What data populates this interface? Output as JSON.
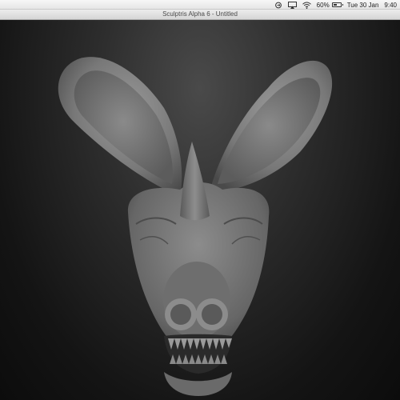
{
  "menubar": {
    "battery_percent": "60%",
    "battery_level": 0.6,
    "date": "Tue 30 Jan",
    "time": "9:40",
    "icons": [
      "sync-icon",
      "airplay-icon",
      "wifi-icon",
      "battery-icon"
    ]
  },
  "window": {
    "title": "Sculptris Alpha 6 - Untitled"
  },
  "viewport": {
    "model_icon": "bat-head-sculpt",
    "background_color": "#1a1a1a"
  }
}
